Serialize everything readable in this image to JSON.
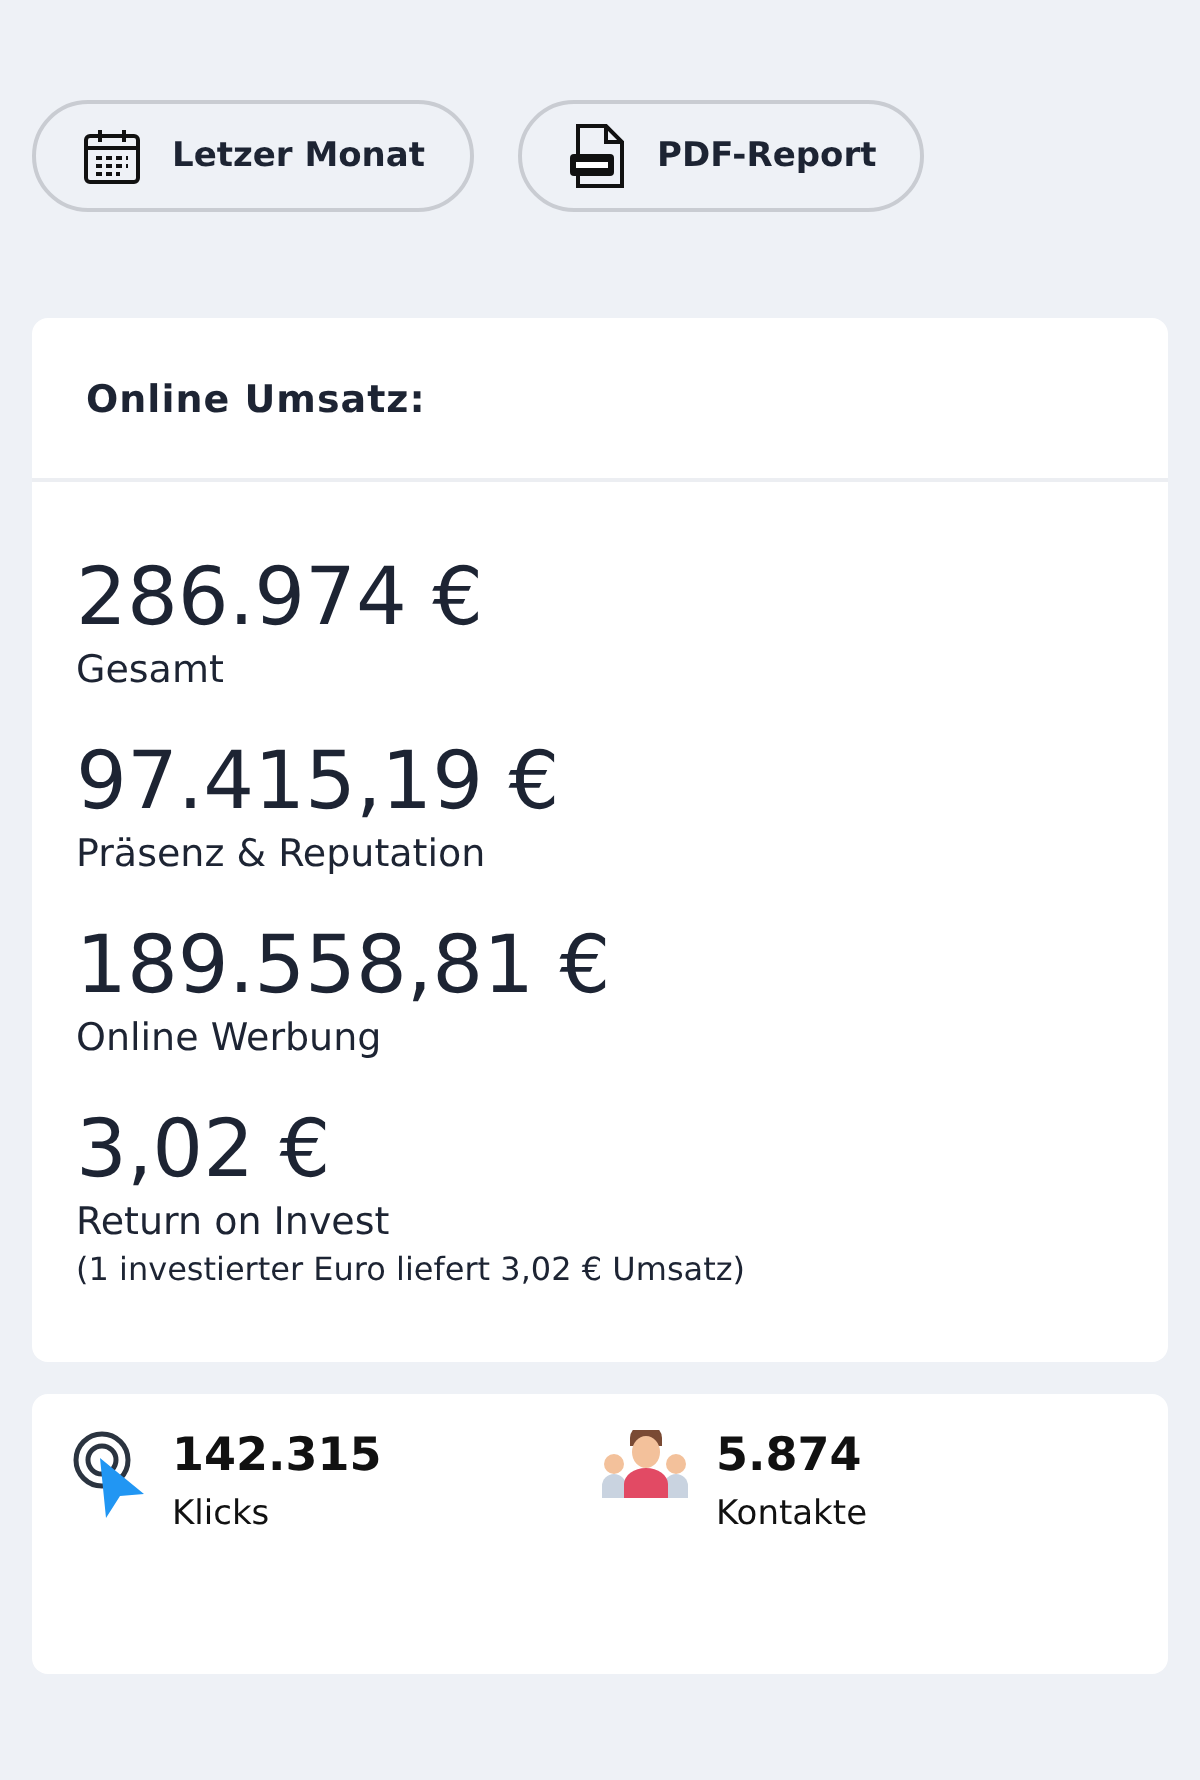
{
  "actions": [
    {
      "kind": "calendar",
      "label": "Letzer Monat"
    },
    {
      "kind": "pdf",
      "label": "PDF-Report"
    }
  ],
  "revenue": {
    "title": "Online Umsatz:",
    "items": [
      {
        "value": "286.974 €",
        "label": "Gesamt"
      },
      {
        "value": "97.415,19 €",
        "label": "Präsenz & Reputation"
      },
      {
        "value": "189.558,81 €",
        "label": "Online Werbung"
      },
      {
        "value": "3,02 €",
        "label": "Return on Invest",
        "note": "(1 investierter Euro liefert 3,02 € Umsatz)"
      }
    ]
  },
  "stats": [
    {
      "kind": "clicks",
      "value": "142.315",
      "label": "Klicks"
    },
    {
      "kind": "contacts",
      "value": "5.874",
      "label": "Kontakte"
    }
  ]
}
